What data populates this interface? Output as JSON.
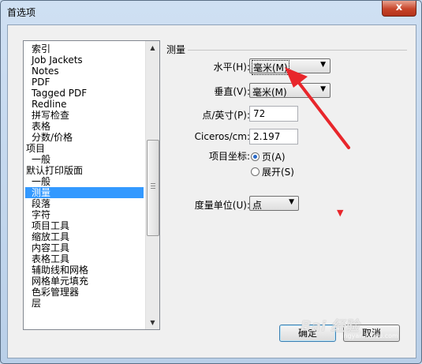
{
  "window": {
    "title": "首选项",
    "close_label": "x"
  },
  "list": {
    "items": [
      {
        "label": "索引",
        "level": 1
      },
      {
        "label": "Job Jackets",
        "level": 1
      },
      {
        "label": "Notes",
        "level": 1
      },
      {
        "label": "PDF",
        "level": 1
      },
      {
        "label": "Tagged PDF",
        "level": 1
      },
      {
        "label": "Redline",
        "level": 1
      },
      {
        "label": "拼写检查",
        "level": 1
      },
      {
        "label": "表格",
        "level": 1
      },
      {
        "label": "分数/价格",
        "level": 1
      },
      {
        "label": "项目",
        "level": 0
      },
      {
        "label": "一般",
        "level": 1
      },
      {
        "label": "默认打印版面",
        "level": 0
      },
      {
        "label": "一般",
        "level": 1
      },
      {
        "label": "测量",
        "level": 1,
        "selected": true
      },
      {
        "label": "段落",
        "level": 1
      },
      {
        "label": "字符",
        "level": 1
      },
      {
        "label": "项目工具",
        "level": 1
      },
      {
        "label": "缩放工具",
        "level": 1
      },
      {
        "label": "内容工具",
        "level": 1
      },
      {
        "label": "表格工具",
        "level": 1
      },
      {
        "label": "辅助线和网格",
        "level": 1
      },
      {
        "label": "网格单元填充",
        "level": 1
      },
      {
        "label": "色彩管理器",
        "level": 1
      },
      {
        "label": "层",
        "level": 1
      }
    ]
  },
  "measure": {
    "section_title": "测量",
    "horizontal_label": "水平(H):",
    "horizontal_value": "毫米(M)",
    "vertical_label": "垂直(V):",
    "vertical_value": "毫米(M)",
    "points_label": "点/英寸(P):",
    "points_value": "72",
    "ciceros_label": "Ciceros/cm:",
    "ciceros_value": "2.197",
    "coord_label": "项目坐标:",
    "coord_page": "页(A)",
    "coord_spread": "展开(S)",
    "degree_label": "度量单位(U):",
    "degree_value": "点"
  },
  "buttons": {
    "ok": "确定",
    "cancel": "取消"
  },
  "watermark": {
    "text": "Bai 经验",
    "sub": "jingyan.baidu.com"
  },
  "colors": {
    "selection": "#3399ff",
    "annotation": "#e8262b"
  }
}
